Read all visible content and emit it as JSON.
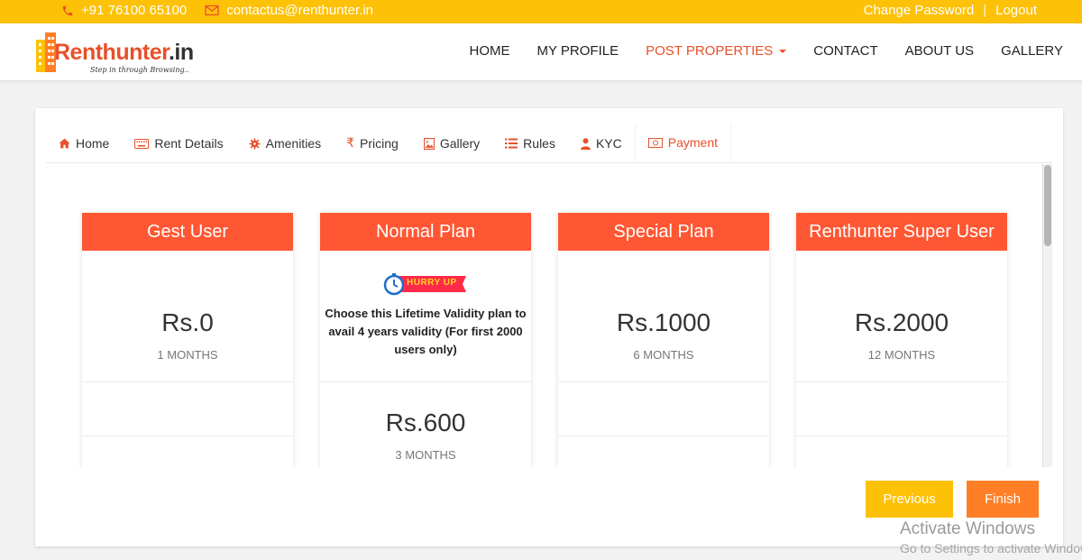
{
  "topbar": {
    "phone": "+91 76100 65100",
    "email": "contactus@renthunter.in",
    "change_password": "Change Password",
    "separator": "|",
    "logout": "Logout",
    "icons": [
      "phone-icon",
      "envelope-icon"
    ]
  },
  "logo": {
    "brand_main": "Renthunter",
    "brand_tld": ".in",
    "tagline": "Step in through Browsing.."
  },
  "nav": {
    "items": [
      "HOME",
      "MY PROFILE",
      "POST PROPERTIES",
      "CONTACT",
      "ABOUT US",
      "GALLERY"
    ],
    "active": "POST PROPERTIES"
  },
  "tabs": [
    {
      "label": "Home",
      "icon": "home-icon"
    },
    {
      "label": "Rent Details",
      "icon": "keyboard-icon"
    },
    {
      "label": "Amenities",
      "icon": "gear-icon"
    },
    {
      "label": "Pricing",
      "icon": "rupee-icon"
    },
    {
      "label": "Gallery",
      "icon": "image-icon"
    },
    {
      "label": "Rules",
      "icon": "list-icon"
    },
    {
      "label": "KYC",
      "icon": "user-icon"
    },
    {
      "label": "Payment",
      "icon": "money-icon"
    }
  ],
  "active_tab": "Payment",
  "plans": [
    {
      "title": "Gest User",
      "price": "Rs.0",
      "duration": "1 MONTHS"
    },
    {
      "title": "Normal Plan",
      "badge": "HURRY UP",
      "promo": "Choose this Lifetime Validity plan to avail 4 years validity (For first 2000 users only)",
      "price": "Rs.600",
      "duration": "3 MONTHS"
    },
    {
      "title": "Special Plan",
      "price": "Rs.1000",
      "duration": "6 MONTHS"
    },
    {
      "title": "Renthunter Super User",
      "price": "Rs.2000",
      "duration": "12 MONTHS"
    }
  ],
  "buttons": {
    "previous": "Previous",
    "finish": "Finish"
  },
  "watermark": {
    "line1": "Activate Windows",
    "line2": "Go to Settings to activate Windows."
  },
  "colors": {
    "topbar": "#fdc107",
    "accent": "#ff5733",
    "previous_button": "#fdc107",
    "finish_button": "#ff7f27"
  }
}
